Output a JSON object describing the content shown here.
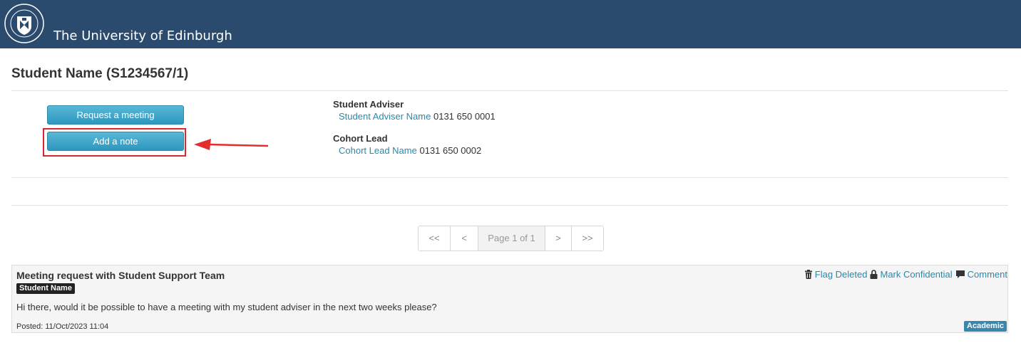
{
  "header": {
    "university_name": "The University of Edinburgh",
    "crest_text": "THE UNIVERSITY OF EDINBURGH",
    "background_color": "#2a4a6e"
  },
  "page": {
    "title": "Student Name (S1234567/1)"
  },
  "actions": {
    "request_meeting_label": "Request a meeting",
    "add_note_label": "Add a note",
    "button_color": "#3aa5ca",
    "highlight_color": "#d9282f"
  },
  "contacts": [
    {
      "role": "Student Adviser",
      "name": "Student Adviser Name",
      "phone": "0131 650 0001"
    },
    {
      "role": "Cohort Lead",
      "name": "Cohort Lead Name",
      "phone": "0131 650 0002"
    }
  ],
  "pagination": {
    "first": "<<",
    "prev": "<",
    "current": "Page 1 of 1",
    "next": ">",
    "last": ">>"
  },
  "posts": [
    {
      "title": "Meeting request with Student Support Team",
      "author": "Student Name",
      "body": "Hi there, would it be possible to have a meeting with my student adviser in the next two weeks please?",
      "posted": "Posted: 11/Oct/2023 11:04",
      "category": "Academic",
      "actions": {
        "flag_deleted": "Flag Deleted",
        "mark_confidential": "Mark Confidential",
        "comment": "Comment"
      }
    }
  ]
}
